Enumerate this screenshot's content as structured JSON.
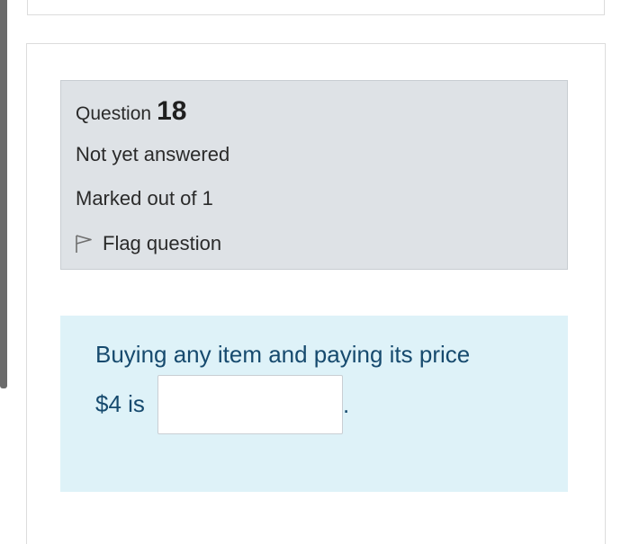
{
  "question": {
    "label": "Question",
    "number": "18",
    "state": "Not yet answered",
    "grade": "Marked out of 1",
    "flag_label": "Flag question"
  },
  "content": {
    "line1": "Buying any item and paying its price",
    "prefix": "$4 is",
    "answer_value": "",
    "suffix": "."
  },
  "colors": {
    "info_background": "#dee2e6",
    "content_background": "#def2f8",
    "question_text": "#164a6e"
  },
  "icons": {
    "flag": "flag-outline-icon"
  }
}
